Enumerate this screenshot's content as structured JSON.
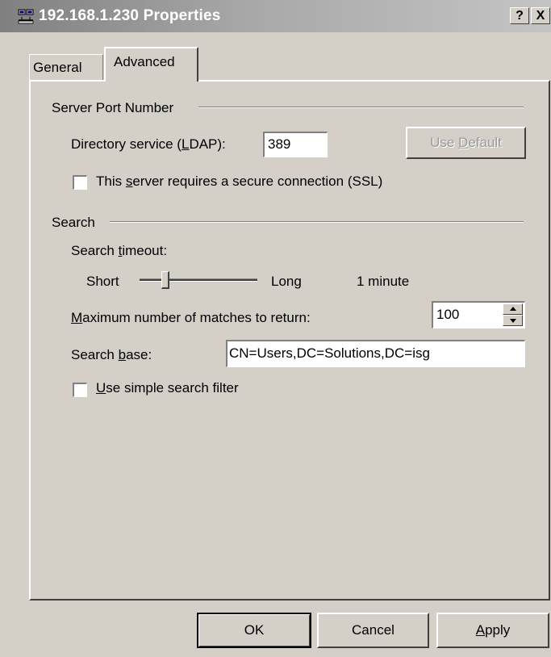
{
  "window": {
    "title": "192.168.1.230 Properties",
    "help_button": "?",
    "close_button": "X",
    "icon": "network-computer-icon"
  },
  "tabs": [
    {
      "label": "General",
      "selected": false
    },
    {
      "label": "Advanced",
      "selected": true
    }
  ],
  "server_port": {
    "group_label": "Server Port Number",
    "ldap_label_before": "Directory service (",
    "ldap_label_key": "L",
    "ldap_label_after": "DAP):",
    "ldap_value": "389",
    "use_default_before": "Use ",
    "use_default_key": "D",
    "use_default_after": "efault",
    "ssl_label_before": "This ",
    "ssl_label_key": "s",
    "ssl_label_after": "erver requires a secure connection (SSL)",
    "ssl_checked": false
  },
  "search": {
    "group_label": "Search",
    "timeout_label_before": "Search ",
    "timeout_label_key": "t",
    "timeout_label_after": "imeout:",
    "slider_min_label": "Short",
    "slider_max_label": "Long",
    "slider_value_text": "1 minute",
    "slider_level": 0.2,
    "max_matches_label_key": "M",
    "max_matches_label_after": "aximum number of matches to return:",
    "max_matches_value": "100",
    "search_base_label_before": "Search ",
    "search_base_label_key": "b",
    "search_base_label_after": "ase:",
    "search_base_value": "CN=Users,DC=Solutions,DC=isg",
    "simple_filter_key": "U",
    "simple_filter_after": "se simple search filter",
    "simple_filter_checked": false
  },
  "buttons": {
    "ok": "OK",
    "cancel": "Cancel",
    "apply_key": "A",
    "apply_after": "pply"
  }
}
